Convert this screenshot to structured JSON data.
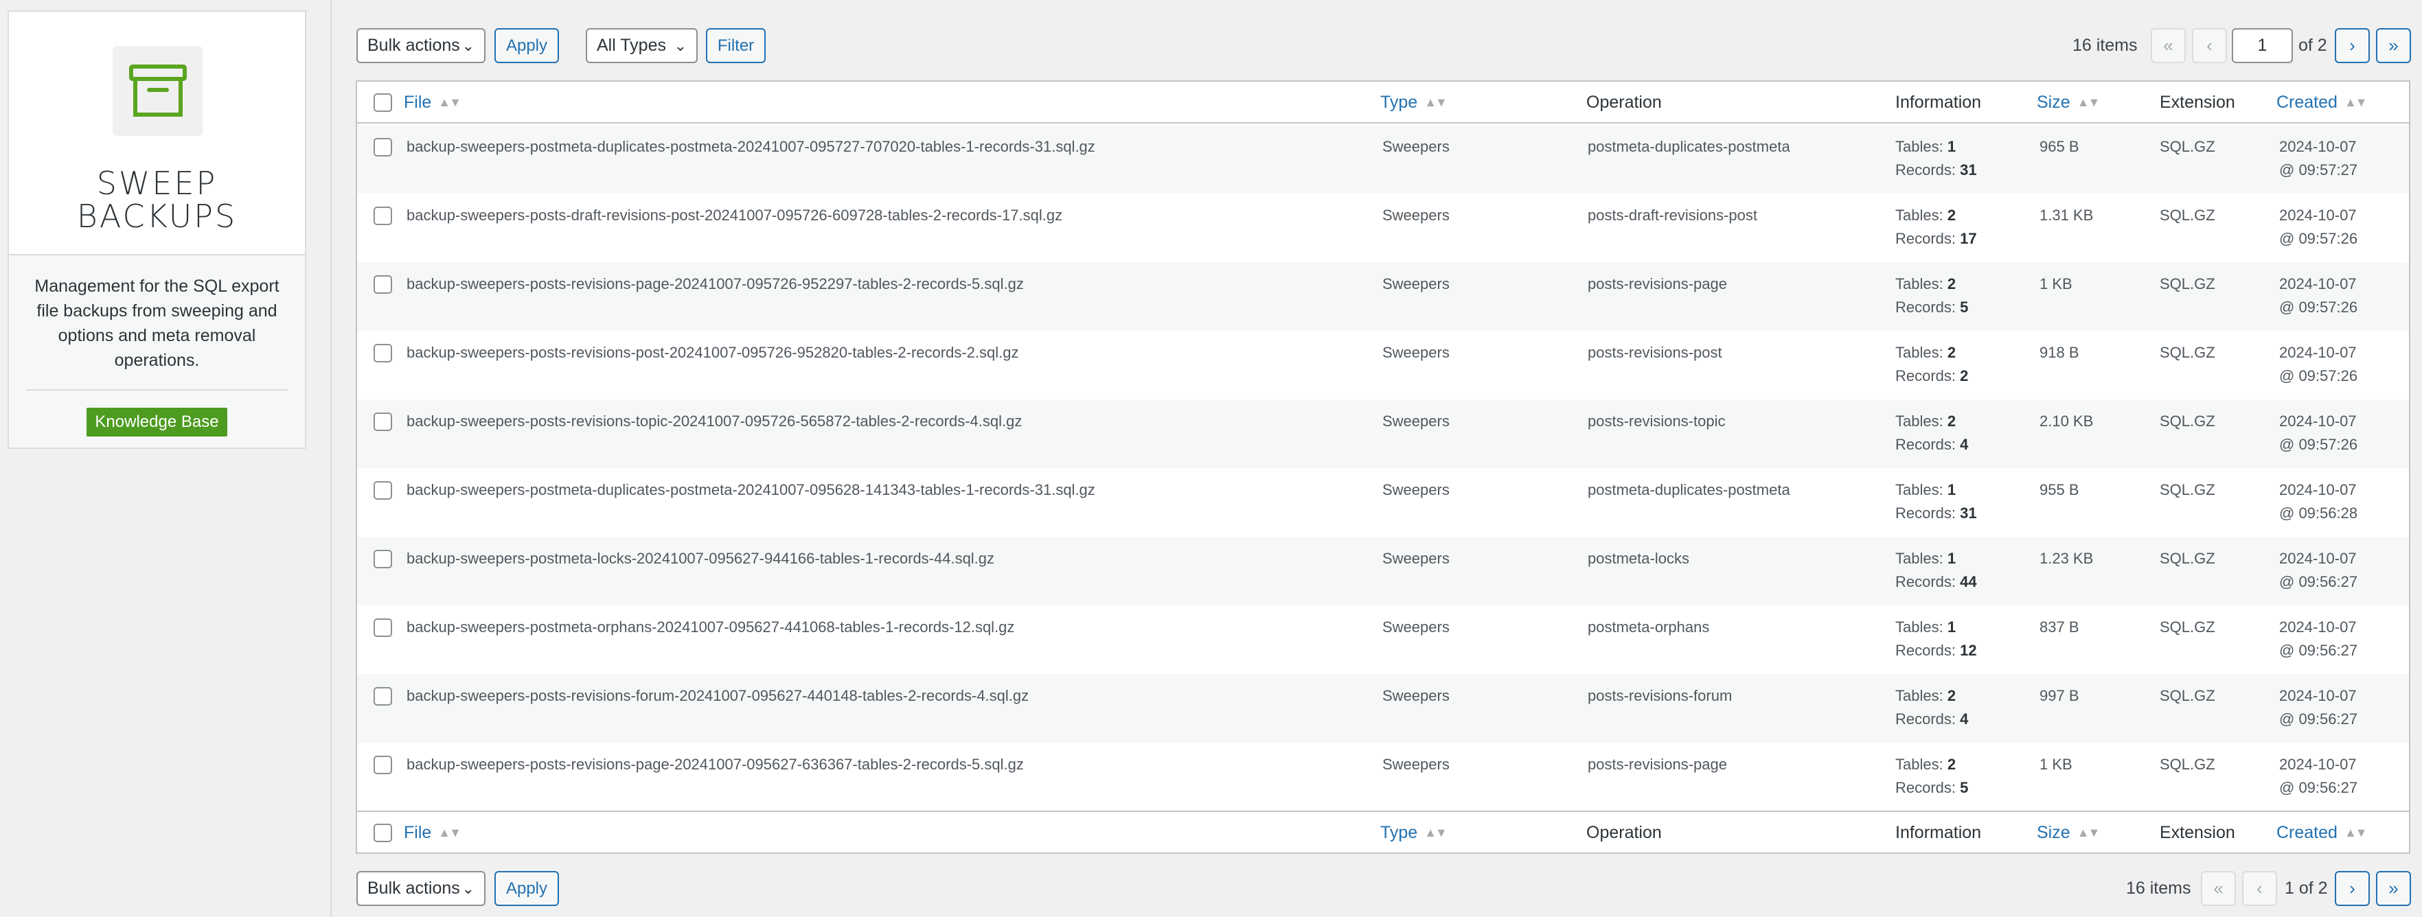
{
  "sidebar": {
    "title_line1": "SWEEP",
    "title_line2": "BACKUPS",
    "description": "Management for the SQL export file backups from sweeping and options and meta removal operations.",
    "kb_button": "Knowledge Base",
    "accent_color": "#5ba51f"
  },
  "toolbar_top": {
    "bulk_actions": "Bulk actions",
    "apply": "Apply",
    "types_filter": "All Types",
    "filter": "Filter",
    "items_count": "16 items",
    "first": "«",
    "prev": "‹",
    "current_page": "1",
    "of_pages": "of 2",
    "next": "›",
    "last": "»"
  },
  "toolbar_bottom": {
    "bulk_actions": "Bulk actions",
    "apply": "Apply",
    "items_count": "16 items",
    "first": "«",
    "prev": "‹",
    "page_info": "1 of 2",
    "next": "›",
    "last": "»"
  },
  "columns": {
    "file": "File",
    "type": "Type",
    "operation": "Operation",
    "information": "Information",
    "size": "Size",
    "extension": "Extension",
    "created": "Created"
  },
  "info_labels": {
    "tables": "Tables:",
    "records": "Records:"
  },
  "rows": [
    {
      "file": "backup-sweepers-postmeta-duplicates-postmeta-20241007-095727-707020-tables-1-records-31.sql.gz",
      "type": "Sweepers",
      "operation": "postmeta-duplicates-postmeta",
      "tables": "1",
      "records": "31",
      "size": "965 B",
      "extension": "SQL.GZ",
      "date": "2024-10-07",
      "time": "@ 09:57:27"
    },
    {
      "file": "backup-sweepers-posts-draft-revisions-post-20241007-095726-609728-tables-2-records-17.sql.gz",
      "type": "Sweepers",
      "operation": "posts-draft-revisions-post",
      "tables": "2",
      "records": "17",
      "size": "1.31 KB",
      "extension": "SQL.GZ",
      "date": "2024-10-07",
      "time": "@ 09:57:26"
    },
    {
      "file": "backup-sweepers-posts-revisions-page-20241007-095726-952297-tables-2-records-5.sql.gz",
      "type": "Sweepers",
      "operation": "posts-revisions-page",
      "tables": "2",
      "records": "5",
      "size": "1 KB",
      "extension": "SQL.GZ",
      "date": "2024-10-07",
      "time": "@ 09:57:26"
    },
    {
      "file": "backup-sweepers-posts-revisions-post-20241007-095726-952820-tables-2-records-2.sql.gz",
      "type": "Sweepers",
      "operation": "posts-revisions-post",
      "tables": "2",
      "records": "2",
      "size": "918 B",
      "extension": "SQL.GZ",
      "date": "2024-10-07",
      "time": "@ 09:57:26"
    },
    {
      "file": "backup-sweepers-posts-revisions-topic-20241007-095726-565872-tables-2-records-4.sql.gz",
      "type": "Sweepers",
      "operation": "posts-revisions-topic",
      "tables": "2",
      "records": "4",
      "size": "2.10 KB",
      "extension": "SQL.GZ",
      "date": "2024-10-07",
      "time": "@ 09:57:26"
    },
    {
      "file": "backup-sweepers-postmeta-duplicates-postmeta-20241007-095628-141343-tables-1-records-31.sql.gz",
      "type": "Sweepers",
      "operation": "postmeta-duplicates-postmeta",
      "tables": "1",
      "records": "31",
      "size": "955 B",
      "extension": "SQL.GZ",
      "date": "2024-10-07",
      "time": "@ 09:56:28"
    },
    {
      "file": "backup-sweepers-postmeta-locks-20241007-095627-944166-tables-1-records-44.sql.gz",
      "type": "Sweepers",
      "operation": "postmeta-locks",
      "tables": "1",
      "records": "44",
      "size": "1.23 KB",
      "extension": "SQL.GZ",
      "date": "2024-10-07",
      "time": "@ 09:56:27"
    },
    {
      "file": "backup-sweepers-postmeta-orphans-20241007-095627-441068-tables-1-records-12.sql.gz",
      "type": "Sweepers",
      "operation": "postmeta-orphans",
      "tables": "1",
      "records": "12",
      "size": "837 B",
      "extension": "SQL.GZ",
      "date": "2024-10-07",
      "time": "@ 09:56:27"
    },
    {
      "file": "backup-sweepers-posts-revisions-forum-20241007-095627-440148-tables-2-records-4.sql.gz",
      "type": "Sweepers",
      "operation": "posts-revisions-forum",
      "tables": "2",
      "records": "4",
      "size": "997 B",
      "extension": "SQL.GZ",
      "date": "2024-10-07",
      "time": "@ 09:56:27"
    },
    {
      "file": "backup-sweepers-posts-revisions-page-20241007-095627-636367-tables-2-records-5.sql.gz",
      "type": "Sweepers",
      "operation": "posts-revisions-page",
      "tables": "2",
      "records": "5",
      "size": "1 KB",
      "extension": "SQL.GZ",
      "date": "2024-10-07",
      "time": "@ 09:56:27"
    }
  ]
}
